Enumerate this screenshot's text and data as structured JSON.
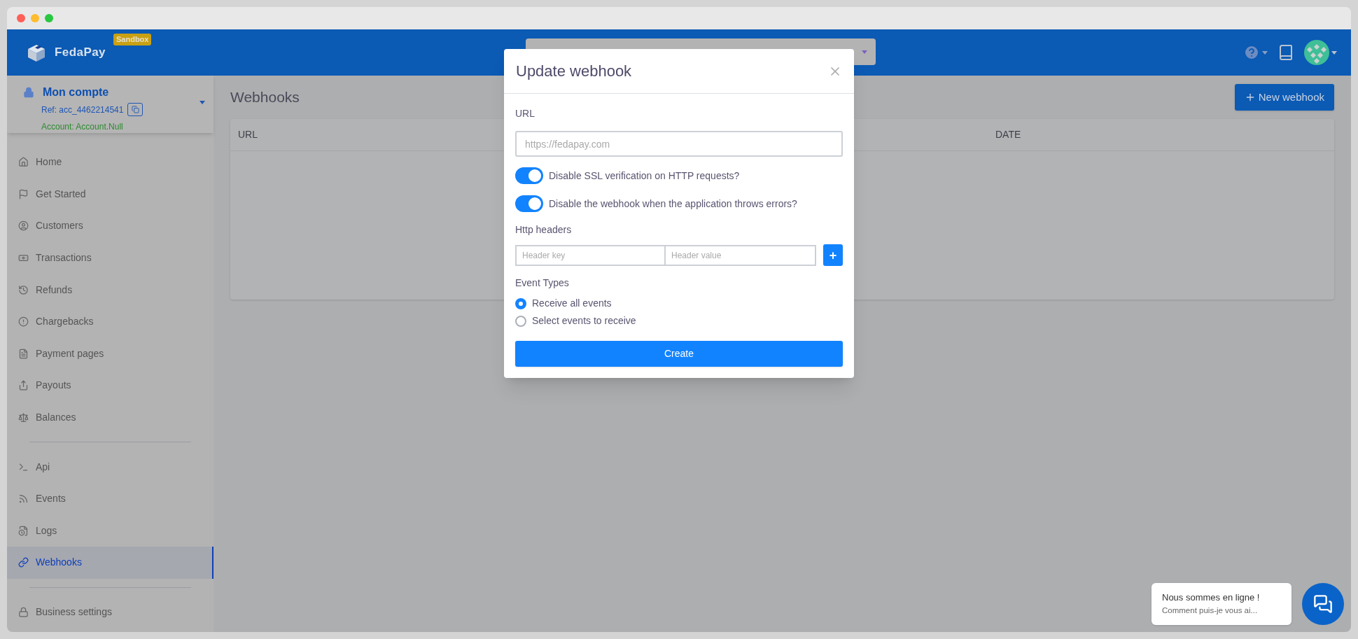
{
  "header": {
    "brand": "FedaPay",
    "badge": "Sandbox"
  },
  "account": {
    "title": "Mon compte",
    "ref": "Ref: acc_4462214541",
    "name": "Account: Account.Null"
  },
  "sidebar": {
    "sections": [
      {
        "items": [
          {
            "label": "Home",
            "selected": false
          },
          {
            "label": "Get Started",
            "selected": false
          },
          {
            "label": "Customers",
            "selected": false
          },
          {
            "label": "Transactions",
            "selected": false
          },
          {
            "label": "Refunds",
            "selected": false
          },
          {
            "label": "Chargebacks",
            "selected": false
          },
          {
            "label": "Payment pages",
            "selected": false
          },
          {
            "label": "Payouts",
            "selected": false
          },
          {
            "label": "Balances",
            "selected": false
          }
        ]
      },
      {
        "items": [
          {
            "label": "Api",
            "selected": false
          },
          {
            "label": "Events",
            "selected": false
          },
          {
            "label": "Logs",
            "selected": false
          },
          {
            "label": "Webhooks",
            "selected": true
          }
        ]
      },
      {
        "items": [
          {
            "label": "Business settings",
            "selected": false
          }
        ]
      }
    ]
  },
  "page": {
    "title": "Webhooks",
    "new_button": "New webhook",
    "table": {
      "columns": [
        "URL",
        "DATE"
      ]
    }
  },
  "modal": {
    "title": "Update webhook",
    "url_label": "URL",
    "url_placeholder": "https://fedapay.com",
    "toggles": [
      {
        "label": "Disable SSL verification on HTTP requests?",
        "on": true
      },
      {
        "label": "Disable the webhook when the application throws errors?",
        "on": true
      }
    ],
    "headers_label": "Http headers",
    "key_placeholder": "Header key",
    "value_placeholder": "Header value",
    "add_button": "+",
    "event_types_label": "Event Types",
    "radios": [
      {
        "label": "Receive all events",
        "selected": true
      },
      {
        "label": "Select events to receive",
        "selected": false
      }
    ],
    "submit": "Create"
  },
  "chat": {
    "title": "Nous sommes en ligne !",
    "message": "Comment puis-je vous ai..."
  }
}
